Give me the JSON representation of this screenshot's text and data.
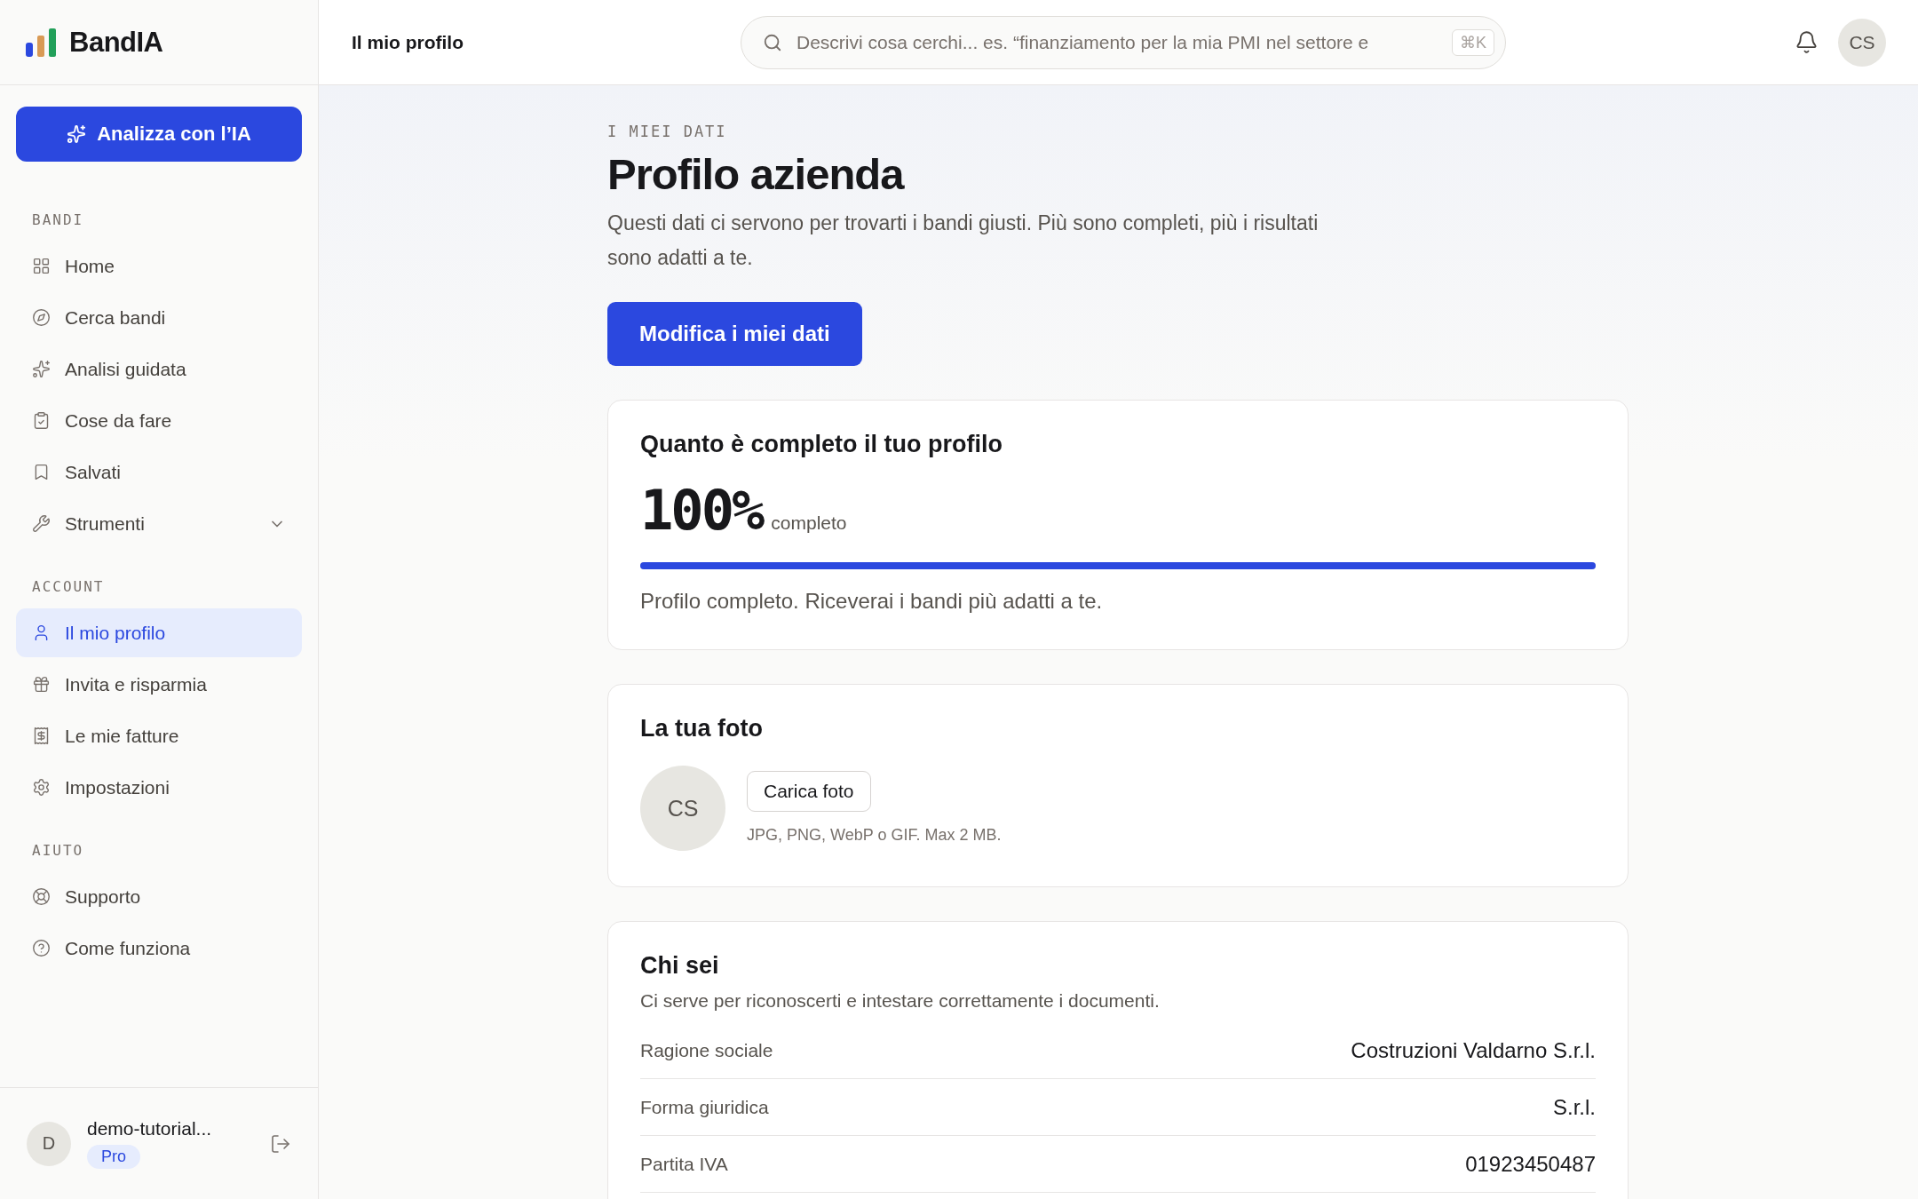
{
  "brand": {
    "name": "BandIA"
  },
  "cta": {
    "label": "Analizza con l’IA"
  },
  "nav_sections": [
    {
      "title": "BANDI",
      "items": [
        {
          "label": "Home",
          "selected": false
        },
        {
          "label": "Cerca bandi",
          "selected": false
        },
        {
          "label": "Analisi guidata",
          "selected": false
        },
        {
          "label": "Cose da fare",
          "selected": false
        },
        {
          "label": "Salvati",
          "selected": false
        },
        {
          "label": "Strumenti",
          "selected": false,
          "expanded": false
        }
      ]
    },
    {
      "title": "ACCOUNT",
      "items": [
        {
          "label": "Il mio profilo",
          "selected": true
        },
        {
          "label": "Invita e risparmia",
          "selected": false
        },
        {
          "label": "Le mie fatture",
          "selected": false
        },
        {
          "label": "Impostazioni",
          "selected": false
        }
      ]
    },
    {
      "title": "AIUTO",
      "items": [
        {
          "label": "Supporto",
          "selected": false
        },
        {
          "label": "Come funziona",
          "selected": false
        }
      ]
    }
  ],
  "user": {
    "avatar": "D",
    "name": "demo-tutorial...",
    "plan": "Pro"
  },
  "topbar": {
    "title": "Il mio profilo",
    "search": {
      "placeholder": "Descrivi cosa cerchi... es. “finanziamento per la mia PMI nel settore e",
      "shortcut": "⌘K"
    },
    "avatar": "CS"
  },
  "page": {
    "eyebrow": "I MIEI DATI",
    "title": "Profilo azienda",
    "intro": "Questi dati ci servono per trovarti i bandi giusti. Più sono completi, più i risultati sono adatti a te.",
    "edit_button": "Modifica i miei dati"
  },
  "completeness": {
    "title": "Quanto è completo il tuo profilo",
    "percent": "100%",
    "unit": "completo",
    "level": 1.0,
    "message": "Profilo completo. Riceverai i bandi più adatti a te."
  },
  "photo": {
    "title": "La tua foto",
    "avatar": "CS",
    "upload_button": "Carica foto",
    "hint": "JPG, PNG, WebP o GIF. Max 2 MB."
  },
  "identity": {
    "title": "Chi sei",
    "subtitle": "Ci serve per riconoscerti e intestare correttamente i documenti.",
    "rows": [
      {
        "label": "Ragione sociale",
        "value": "Costruzioni Valdarno S.r.l."
      },
      {
        "label": "Forma giuridica",
        "value": "S.r.l."
      },
      {
        "label": "Partita IVA",
        "value": "01923450487"
      }
    ]
  }
}
